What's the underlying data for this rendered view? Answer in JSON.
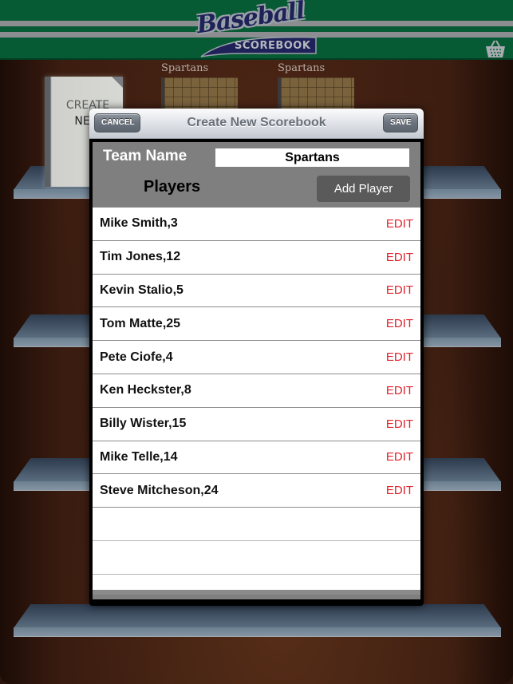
{
  "header": {
    "logo_script": "Baseball",
    "logo_subtitle": "SCOREBOOK",
    "store_icon": "basket-icon",
    "colors": {
      "green": "#075b34",
      "stripe": "#8b8d91",
      "navy": "#1e2258"
    }
  },
  "bookshelf": {
    "create_new_book": {
      "line1": "CREATE",
      "line2": "NEW"
    },
    "books": [
      {
        "title": "Spartans"
      },
      {
        "title": "Spartans"
      }
    ]
  },
  "dialog": {
    "title": "Create New Scorebook",
    "cancel_label": "CANCEL",
    "save_label": "SAVE",
    "team_name_label": "Team Name",
    "team_name_value": "Spartans",
    "players_label": "Players",
    "add_player_label": "Add Player",
    "edit_label": "EDIT",
    "edit_color": "#e0202a",
    "players": [
      {
        "name": "Mike Smith,3"
      },
      {
        "name": "Tim Jones,12"
      },
      {
        "name": "Kevin Stalio,5"
      },
      {
        "name": "Tom Matte,25"
      },
      {
        "name": "Pete Ciofe,4"
      },
      {
        "name": "Ken Heckster,8"
      },
      {
        "name": "Billy Wister,15"
      },
      {
        "name": "Mike Telle,14"
      },
      {
        "name": "Steve Mitcheson,24"
      }
    ],
    "empty_rows": 3
  }
}
